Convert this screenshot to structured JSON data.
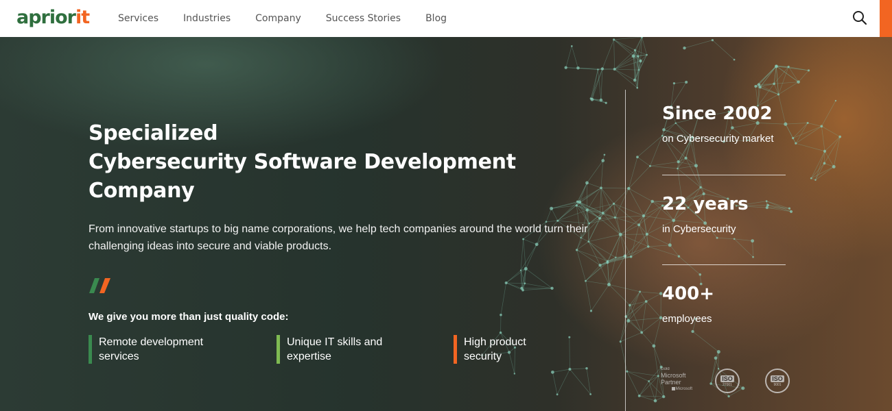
{
  "header": {
    "logo": {
      "part1": "aprior",
      "part2": "it"
    },
    "nav": [
      {
        "label": "Services"
      },
      {
        "label": "Industries"
      },
      {
        "label": "Company"
      },
      {
        "label": "Success Stories"
      },
      {
        "label": "Blog"
      }
    ],
    "search_icon": "search-icon"
  },
  "hero": {
    "title": [
      "Specialized",
      "Cybersecurity Software Development",
      "Company"
    ],
    "subtitle": "From innovative startups to big name corporations, we help tech companies around the world turn their challenging ideas into secure and viable products.",
    "tagline": "We give you more than just quality code:",
    "features": [
      {
        "lines": [
          "Remote development",
          "services"
        ],
        "color": "#3a8a4f"
      },
      {
        "lines": [
          "Unique IT skills and",
          "expertise"
        ],
        "color": "#7fba52"
      },
      {
        "lines": [
          "High product",
          "security"
        ],
        "color": "#f26522"
      }
    ]
  },
  "stats": [
    {
      "value": "Since 2002",
      "label": "on Cybersecurity market"
    },
    {
      "value": "22 years",
      "label": "in Cybersecurity"
    },
    {
      "value": "400+",
      "label": "employees"
    }
  ],
  "badges": {
    "microsoft": {
      "gold": "Gold",
      "name_line1": "Microsoft",
      "name_line2": "Partner",
      "brand": "Microsoft"
    },
    "iso1": {
      "text": "ISO",
      "year": "27001"
    },
    "iso2": {
      "text": "ISO",
      "year": "9001"
    }
  },
  "colors": {
    "brand_green": "#2f6f3e",
    "brand_orange": "#f26522"
  }
}
